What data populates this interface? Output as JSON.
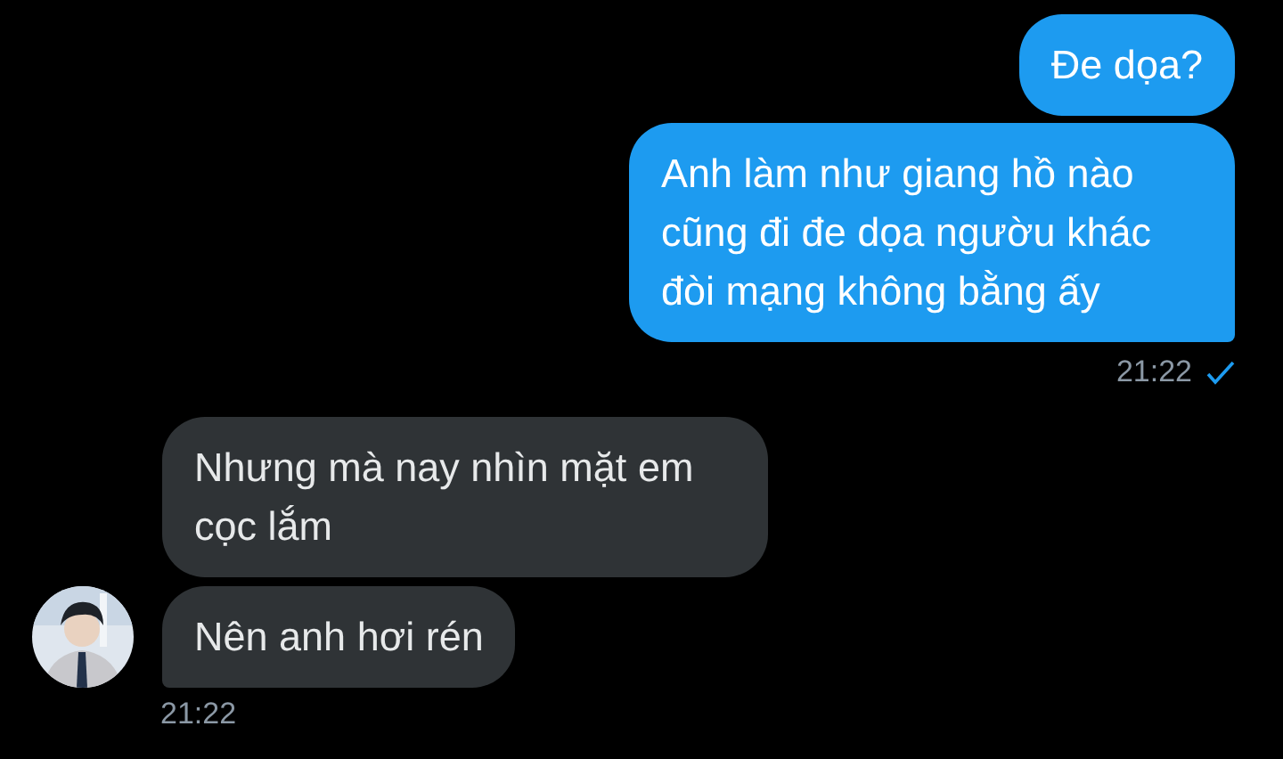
{
  "groups": [
    {
      "kind": "sent",
      "messages": [
        "Đe dọa?",
        "Anh làm như giang hồ nào cũng đi đe dọa ngườu khác đòi mạng không bằng ấy"
      ],
      "time": "21:22",
      "seen": true
    },
    {
      "kind": "received",
      "messages": [
        "Nhưng mà nay nhìn mặt em cọc lắm",
        "Nên anh hơi rén"
      ],
      "time": "21:22"
    }
  ]
}
